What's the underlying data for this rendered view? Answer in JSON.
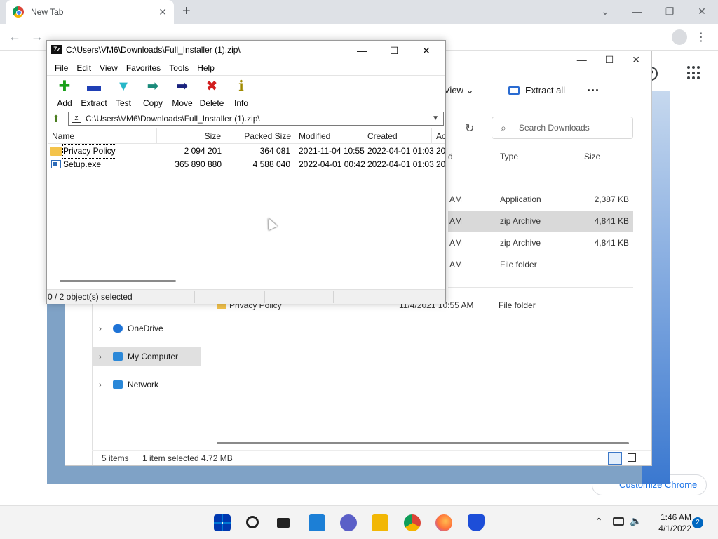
{
  "chrome": {
    "tab_title": "New Tab",
    "tab_close": "✕",
    "new_tab": "+",
    "minimize": "—",
    "restore": "❐",
    "close": "✕",
    "chevron": "⌄",
    "back": "←",
    "forward": "→",
    "menu": "⋮",
    "customize": "Customize Chrome"
  },
  "explorer": {
    "view_label": "View",
    "extract_all_label": "Extract all",
    "more": "···",
    "search_placeholder": "Search Downloads",
    "columns": {
      "type": "Type",
      "size": "Size",
      "date_partial": "d"
    },
    "rows": [
      {
        "time": "AM",
        "type": "Application",
        "size": "2,387 KB",
        "selected": false
      },
      {
        "time": "AM",
        "type": "zip Archive",
        "size": "4,841 KB",
        "selected": true
      },
      {
        "time": "AM",
        "type": "zip Archive",
        "size": "4,841 KB",
        "selected": false
      },
      {
        "time": "AM",
        "type": "File folder",
        "size": "",
        "selected": false
      }
    ],
    "privacy_row": {
      "name": "Privacy Policy",
      "date": "11/4/2021 10:55 AM",
      "type": "File folder"
    },
    "nav": [
      {
        "label": "OneDrive",
        "icon": "cloud-icon",
        "color": "#1e73d6",
        "selected": false
      },
      {
        "label": "My Computer",
        "icon": "computer-icon",
        "color": "#2b88d8",
        "selected": true
      },
      {
        "label": "Network",
        "icon": "network-icon",
        "color": "#2b88d8",
        "selected": false
      }
    ],
    "status": {
      "items": "5 items",
      "selected": "1 item selected  4.72 MB"
    }
  },
  "sevenzip": {
    "app_icon_text": "7z",
    "title": "C:\\Users\\VM6\\Downloads\\Full_Installer (1).zip\\",
    "menu": [
      "File",
      "Edit",
      "View",
      "Favorites",
      "Tools",
      "Help"
    ],
    "toolbar": [
      {
        "label": "Add",
        "icon": "add-icon",
        "glyph": "✚",
        "color": "#1aa01a"
      },
      {
        "label": "Extract",
        "icon": "extract-icon",
        "glyph": "▬",
        "color": "#1f3fb5"
      },
      {
        "label": "Test",
        "icon": "test-icon",
        "glyph": "▼",
        "color": "#27b7c8"
      },
      {
        "label": "Copy",
        "icon": "copy-icon",
        "glyph": "➡",
        "color": "#1a8a7a"
      },
      {
        "label": "Move",
        "icon": "move-icon",
        "glyph": "➡",
        "color": "#1a237e"
      },
      {
        "label": "Delete",
        "icon": "delete-icon",
        "glyph": "✖",
        "color": "#d21f1f"
      },
      {
        "label": "Info",
        "icon": "info-icon",
        "glyph": "ℹ",
        "color": "#a08a00"
      }
    ],
    "address": "C:\\Users\\VM6\\Downloads\\Full_Installer (1).zip\\",
    "columns": [
      "Name",
      "Size",
      "Packed Size",
      "Modified",
      "Created",
      "Ac"
    ],
    "files": [
      {
        "name": "Privacy Policy",
        "size": "2 094 201",
        "packed": "364 081",
        "modified": "2021-11-04 10:55",
        "created": "2022-04-01 01:03",
        "accessed": "20",
        "kind": "folder"
      },
      {
        "name": "Setup.exe",
        "size": "365 890 880",
        "packed": "4 588 040",
        "modified": "2022-04-01 00:42",
        "created": "2022-04-01 01:03",
        "accessed": "20",
        "kind": "exe"
      }
    ],
    "status": "0 / 2 object(s) selected"
  },
  "taskbar": {
    "icons": [
      {
        "name": "start-icon",
        "color": "#0078d4"
      },
      {
        "name": "search-icon",
        "color": "#222222"
      },
      {
        "name": "task-view-icon",
        "color": "#222222"
      },
      {
        "name": "widgets-icon",
        "color": "#1c7fd6"
      },
      {
        "name": "chat-icon",
        "color": "#5b5fc7"
      },
      {
        "name": "file-explorer-icon",
        "color": "#f2b705"
      },
      {
        "name": "chrome-icon",
        "color": "#db4437"
      },
      {
        "name": "firefox-icon",
        "color": "#ff7139"
      },
      {
        "name": "malwarebytes-icon",
        "color": "#1d4ed8"
      }
    ],
    "time": "1:46 AM",
    "date": "4/1/2022",
    "notification_count": "2"
  }
}
